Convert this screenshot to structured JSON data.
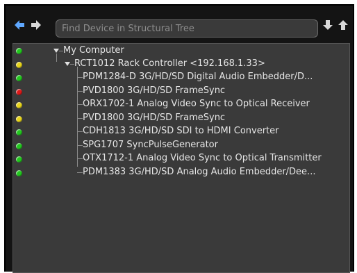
{
  "search": {
    "placeholder": "Find Device in Structural Tree"
  },
  "colors": {
    "green": "#22c81e",
    "yellow": "#e8d51a",
    "red": "#dd1a1a",
    "nav_blue": "#5fa8ff",
    "nav_grey": "#d8d8d8"
  },
  "icons": {
    "back": "arrow-left-icon",
    "forward": "arrow-right-icon",
    "down": "arrow-down-icon",
    "up": "arrow-up-icon"
  },
  "tree": {
    "root": {
      "label": "My Computer",
      "status": "green"
    },
    "controller": {
      "label": "RCT1012 Rack Controller <192.168.1.33>",
      "status": "yellow"
    },
    "devices": [
      {
        "label": "PDM1284-D 3G/HD/SD Digital Audio Embedder/D...",
        "status": "green"
      },
      {
        "label": "PVD1800 3G/HD/SD FrameSync",
        "status": "red"
      },
      {
        "label": "ORX1702-1 Analog Video Sync to Optical Receiver",
        "status": "yellow"
      },
      {
        "label": "PVD1800 3G/HD/SD FrameSync",
        "status": "yellow"
      },
      {
        "label": "CDH1813 3G/HD/SD SDI to HDMI Converter",
        "status": "green"
      },
      {
        "label": "SPG1707 SyncPulseGenerator",
        "status": "green"
      },
      {
        "label": "OTX1712-1 Analog Video Sync to Optical Transmitter",
        "status": "green"
      },
      {
        "label": "PDM1383 3G/HD/SD Analog Audio Embedder/Dee...",
        "status": "green"
      }
    ]
  }
}
